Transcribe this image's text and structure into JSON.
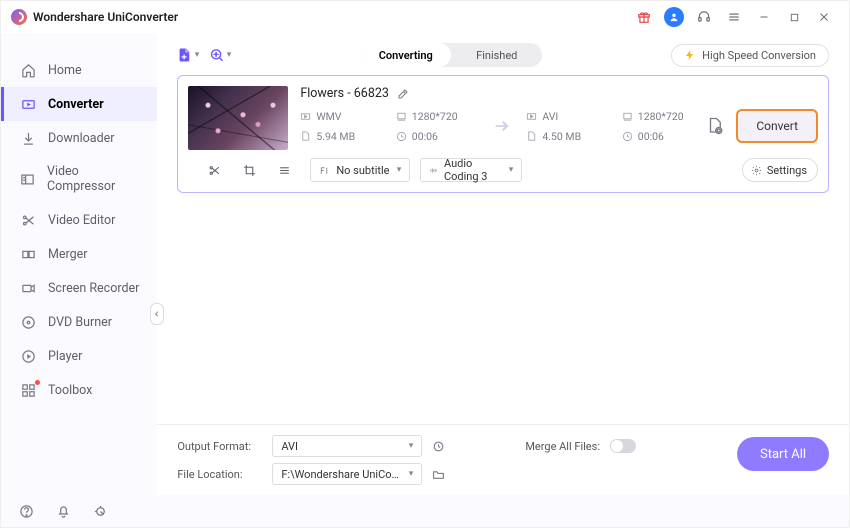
{
  "app_title": "Wondershare UniConverter",
  "sidebar": {
    "items": [
      {
        "label": "Home"
      },
      {
        "label": "Converter"
      },
      {
        "label": "Downloader"
      },
      {
        "label": "Video Compressor"
      },
      {
        "label": "Video Editor"
      },
      {
        "label": "Merger"
      },
      {
        "label": "Screen Recorder"
      },
      {
        "label": "DVD Burner"
      },
      {
        "label": "Player"
      },
      {
        "label": "Toolbox"
      }
    ],
    "active_index": 1
  },
  "topbar": {
    "tabs": {
      "converting": "Converting",
      "finished": "Finished",
      "active": "converting"
    },
    "high_speed_label": "High Speed Conversion"
  },
  "file": {
    "name": "Flowers - 66823",
    "source": {
      "format": "WMV",
      "resolution": "1280*720",
      "size": "5.94 MB",
      "duration": "00:06"
    },
    "target": {
      "format": "AVI",
      "resolution": "1280*720",
      "size": "4.50 MB",
      "duration": "00:06"
    },
    "subtitle_label": "No subtitle",
    "audio_label": "Audio Coding 3",
    "settings_label": "Settings",
    "convert_label": "Convert"
  },
  "bottom": {
    "output_format_label": "Output Format:",
    "output_format_value": "AVI",
    "file_location_label": "File Location:",
    "file_location_value": "F:\\Wondershare UniConverter",
    "merge_label": "Merge All Files:",
    "start_all_label": "Start All"
  }
}
